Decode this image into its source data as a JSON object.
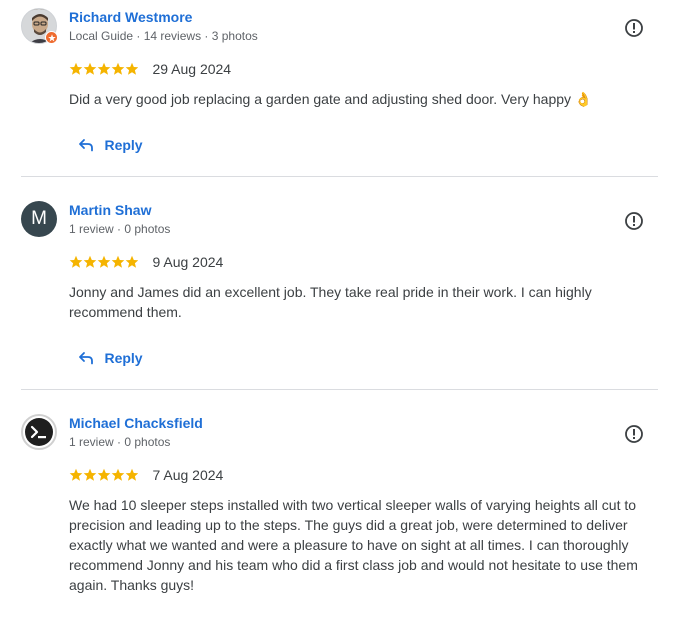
{
  "reviews": [
    {
      "name": "Richard Westmore",
      "meta": "Local Guide · 14 reviews · 3 photos",
      "rating": 5,
      "date": "29 Aug 2024",
      "text": "Did a very good job replacing a garden gate and adjusting shed door. Very happy 👌",
      "reply_label": "Reply",
      "avatar_type": "photo",
      "local_guide_badge": true
    },
    {
      "name": "Martin Shaw",
      "meta": "1 review · 0 photos",
      "rating": 5,
      "date": "9 Aug 2024",
      "text": "Jonny and James did an excellent job. They take real pride in their work. I can highly recommend them.",
      "reply_label": "Reply",
      "avatar_type": "letter",
      "avatar_letter": "M",
      "avatar_color": "#37474f"
    },
    {
      "name": "Michael Chacksfield",
      "meta": "1 review · 0 photos",
      "rating": 5,
      "date": "7 Aug 2024",
      "text": "We had 10 sleeper steps installed with two vertical sleeper walls of varying heights all cut to precision and leading up to the steps. The guys did a great job, were determined to deliver exactly what we wanted and were a pleasure to have on sight at all times. I can thoroughly recommend Jonny and his team who did a first class job and would not hesitate to use them again. Thanks guys!",
      "avatar_type": "terminal-icon"
    }
  ],
  "colors": {
    "name": "#1f6fd6",
    "star": "#f5b400",
    "text": "#3c4043",
    "meta": "#5f6368",
    "divider": "#dadce0"
  },
  "icons": {
    "flag": "report-icon",
    "reply": "reply-arrow-icon",
    "star": "star-icon"
  }
}
